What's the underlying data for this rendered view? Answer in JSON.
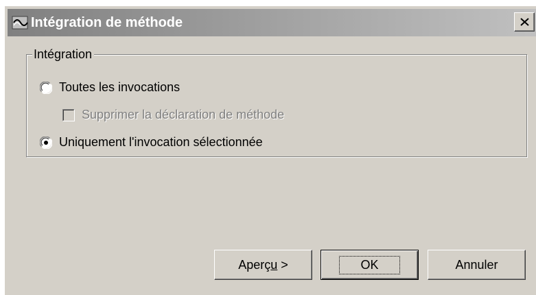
{
  "window": {
    "title": "Intégration de méthode",
    "icon": "refactor-icon",
    "close_icon": "close-icon"
  },
  "group": {
    "legend": "Intégration",
    "options": [
      {
        "label": "Toutes les invocations",
        "type": "radio",
        "checked": false,
        "enabled": true
      },
      {
        "label": "Supprimer la déclaration de méthode",
        "type": "checkbox",
        "checked": false,
        "enabled": false
      },
      {
        "label": "Uniquement l'invocation sélectionnée",
        "type": "radio",
        "checked": true,
        "enabled": true
      }
    ]
  },
  "buttons": {
    "preview_label_pre": "Aperç",
    "preview_label_mnemonic": "u",
    "preview_label_post": " >",
    "ok_label": "OK",
    "cancel_label": "Annuler"
  },
  "colors": {
    "face": "#d4d0c8",
    "title_gradient_start": "#808080",
    "title_gradient_end": "#c0c0c0",
    "disabled_text": "#808080"
  }
}
